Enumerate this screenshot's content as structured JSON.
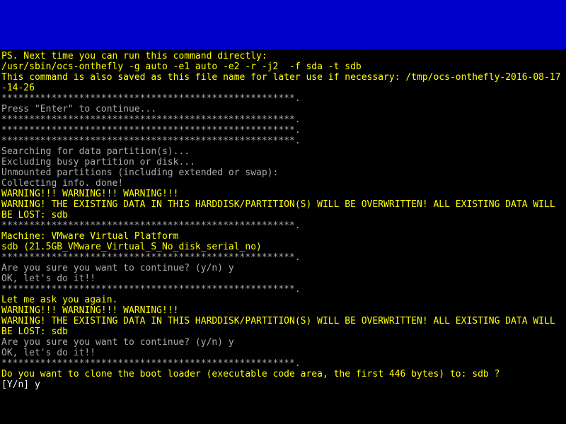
{
  "lines": [
    {
      "cls": "yellow",
      "text": "PS. Next time you can run this command directly:"
    },
    {
      "cls": "yellow",
      "text": "/usr/sbin/ocs-onthefly -g auto -e1 auto -e2 -r -j2  -f sda -t sdb"
    },
    {
      "cls": "yellow",
      "text": "This command is also saved as this file name for later use if necessary: /tmp/ocs-onthefly-2016-08-17-14-26"
    },
    {
      "cls": "white",
      "text": "*****************************************************."
    },
    {
      "cls": "white",
      "text": "Press \"Enter\" to continue..."
    },
    {
      "cls": "white",
      "text": "*****************************************************."
    },
    {
      "cls": "white",
      "text": "*****************************************************."
    },
    {
      "cls": "white",
      "text": "*****************************************************."
    },
    {
      "cls": "white",
      "text": "Searching for data partition(s)..."
    },
    {
      "cls": "white",
      "text": "Excluding busy partition or disk..."
    },
    {
      "cls": "white",
      "text": "Unmounted partitions (including extended or swap):"
    },
    {
      "cls": "white",
      "text": "Collecting info. done!"
    },
    {
      "cls": "yellow",
      "text": "WARNING!!! WARNING!!! WARNING!!!"
    },
    {
      "cls": "yellow",
      "text": "WARNING! THE EXISTING DATA IN THIS HARDDISK/PARTITION(S) WILL BE OVERWRITTEN! ALL EXISTING DATA WILL BE LOST: sdb"
    },
    {
      "cls": "white",
      "text": "*****************************************************."
    },
    {
      "cls": "yellow",
      "text": "Machine: VMware Virtual Platform"
    },
    {
      "cls": "yellow",
      "text": "sdb (21.5GB_VMware_Virtual_S_No_disk_serial_no)"
    },
    {
      "cls": "white",
      "text": "*****************************************************."
    },
    {
      "cls": "white",
      "text": "Are you sure you want to continue? (y/n) y"
    },
    {
      "cls": "white",
      "text": "OK, let's do it!!"
    },
    {
      "cls": "white",
      "text": "*****************************************************."
    },
    {
      "cls": "yellow",
      "text": "Let me ask you again."
    },
    {
      "cls": "yellow",
      "text": "WARNING!!! WARNING!!! WARNING!!!"
    },
    {
      "cls": "yellow",
      "text": "WARNING! THE EXISTING DATA IN THIS HARDDISK/PARTITION(S) WILL BE OVERWRITTEN! ALL EXISTING DATA WILL BE LOST: sdb"
    },
    {
      "cls": "white",
      "text": "Are you sure you want to continue? (y/n) y"
    },
    {
      "cls": "white",
      "text": "OK, let's do it!!"
    },
    {
      "cls": "white",
      "text": "*****************************************************."
    },
    {
      "cls": "yellow",
      "text": "Do you want to clone the boot loader (executable code area, the first 446 bytes) to: sdb ?"
    },
    {
      "cls": "bright-white",
      "text": "[Y/n] y"
    }
  ]
}
